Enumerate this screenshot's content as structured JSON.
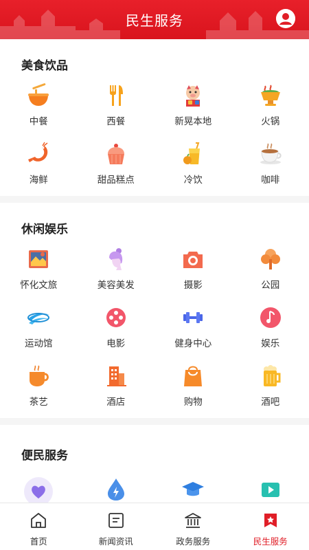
{
  "header": {
    "title": "民生服务",
    "accent_color": "#e01e27",
    "icons": {
      "profile": "user-avatar-icon"
    }
  },
  "sections": [
    {
      "title": "美食饮品",
      "items": [
        {
          "label": "中餐",
          "icon": "noodle-bowl-icon"
        },
        {
          "label": "西餐",
          "icon": "fork-knife-icon"
        },
        {
          "label": "新晃本地",
          "icon": "mascot-icon"
        },
        {
          "label": "火锅",
          "icon": "hotpot-icon"
        },
        {
          "label": "海鲜",
          "icon": "shrimp-icon"
        },
        {
          "label": "甜品糕点",
          "icon": "cupcake-icon"
        },
        {
          "label": "冷饮",
          "icon": "cold-drink-icon"
        },
        {
          "label": "咖啡",
          "icon": "coffee-cup-icon"
        }
      ]
    },
    {
      "title": "休闲娱乐",
      "items": [
        {
          "label": "怀化文旅",
          "icon": "travel-map-icon"
        },
        {
          "label": "美容美发",
          "icon": "woman-head-icon"
        },
        {
          "label": "摄影",
          "icon": "camera-icon"
        },
        {
          "label": "公园",
          "icon": "tree-icon"
        },
        {
          "label": "运动馆",
          "icon": "swoosh-icon"
        },
        {
          "label": "电影",
          "icon": "film-reel-icon"
        },
        {
          "label": "健身中心",
          "icon": "dumbbell-icon"
        },
        {
          "label": "娱乐",
          "icon": "music-note-icon"
        },
        {
          "label": "茶艺",
          "icon": "tea-cup-icon"
        },
        {
          "label": "酒店",
          "icon": "hotel-building-icon"
        },
        {
          "label": "购物",
          "icon": "shopping-bag-icon"
        },
        {
          "label": "酒吧",
          "icon": "beer-mug-icon"
        }
      ]
    },
    {
      "title": "便民服务",
      "items": [
        {
          "label": "",
          "icon": "heart-care-icon"
        },
        {
          "label": "",
          "icon": "water-drop-icon"
        },
        {
          "label": "",
          "icon": "graduation-cap-icon"
        },
        {
          "label": "",
          "icon": "video-play-icon"
        }
      ]
    }
  ],
  "tabbar": {
    "active_color": "#e01e27",
    "tabs": [
      {
        "label": "首页",
        "icon": "home-icon",
        "active": false
      },
      {
        "label": "新闻资讯",
        "icon": "news-icon",
        "active": false
      },
      {
        "label": "政务服务",
        "icon": "government-icon",
        "active": false
      },
      {
        "label": "民生服务",
        "icon": "service-badge-icon",
        "active": true
      }
    ]
  }
}
